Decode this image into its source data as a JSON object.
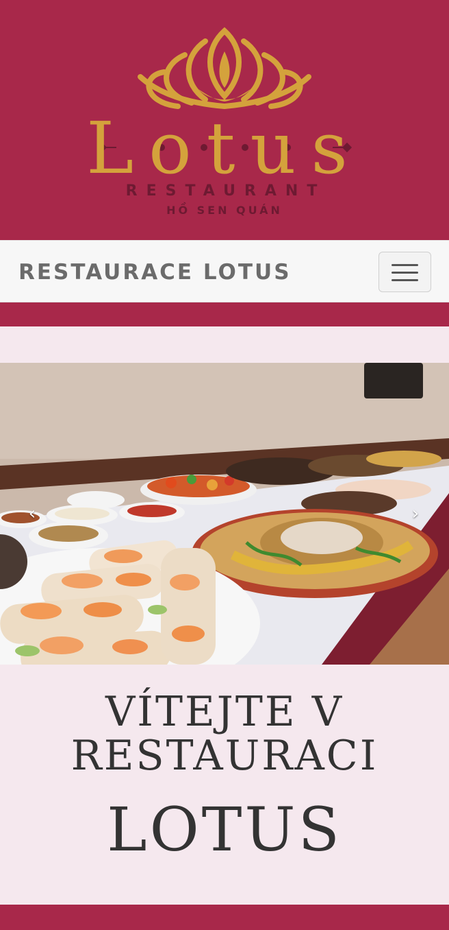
{
  "header": {
    "logo_word": "Lotus",
    "logo_sub1": "RESTAURANT",
    "logo_sub2": "HỒ SEN QUÁN",
    "colors": {
      "background": "#a8284a",
      "gold": "#d4a23c",
      "dark": "#6e1a32"
    }
  },
  "navbar": {
    "brand": "RESTAURACE LOTUS",
    "toggle_icon": "hamburger-icon"
  },
  "carousel": {
    "prev_icon": "chevron-left-icon",
    "next_icon": "chevron-right-icon",
    "prev_glyph": "‹",
    "next_glyph": "›"
  },
  "welcome": {
    "line1": "VÍTEJTE V RESTAURACI",
    "line2": "LOTUS"
  }
}
